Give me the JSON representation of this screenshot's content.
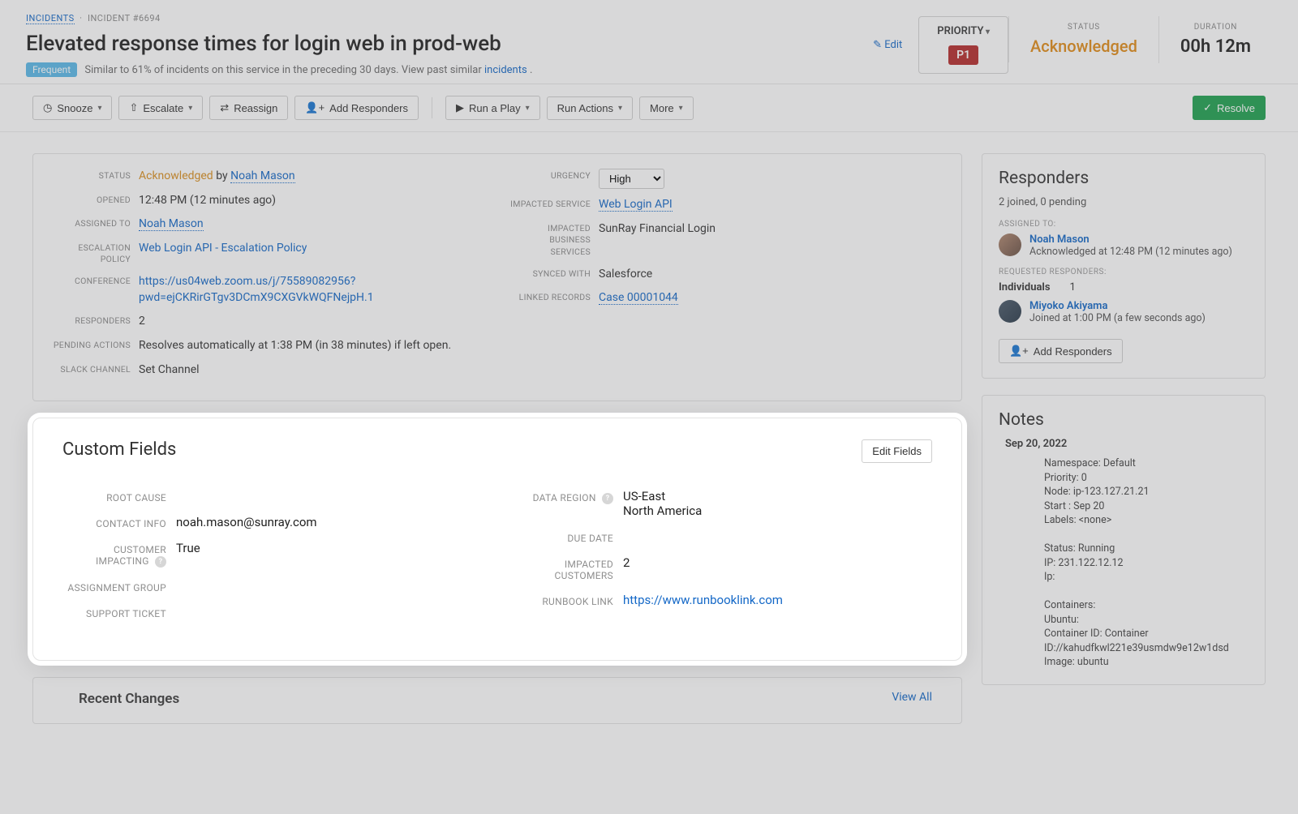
{
  "breadcrumb": {
    "root": "INCIDENTS",
    "current": "INCIDENT #6694"
  },
  "title": "Elevated response times for login web in prod-web",
  "frequentBadge": "Frequent",
  "similarText": "Similar to 61% of incidents on this service in the preceding 30 days. View past similar ",
  "incidentsLink": "incidents",
  "period": " .",
  "editLabel": "Edit",
  "headerBoxes": {
    "priorityLabel": "PRIORITY",
    "priorityValue": "P1",
    "statusLabel": "STATUS",
    "statusValue": "Acknowledged",
    "durationLabel": "DURATION",
    "durationValue": "00h 12m"
  },
  "actions": {
    "snooze": "Snooze",
    "escalate": "Escalate",
    "reassign": "Reassign",
    "addResponders": "Add Responders",
    "runPlay": "Run a Play",
    "runActions": "Run Actions",
    "more": "More",
    "resolve": "Resolve"
  },
  "details": {
    "left": {
      "statusLabel": "STATUS",
      "statusValue": "Acknowledged",
      "statusBy": "by",
      "statusUser": "Noah Mason",
      "openedLabel": "OPENED",
      "openedValue": "12:48 PM (12 minutes ago)",
      "assignedLabel": "ASSIGNED TO",
      "assignedValue": "Noah Mason",
      "escalationLabel": "ESCALATION POLICY",
      "escalationValue": "Web Login API - Escalation Policy",
      "conferenceLabel": "CONFERENCE",
      "conferenceValue": "https://us04web.zoom.us/j/75589082956?pwd=ejCKRirGTgv3DCmX9CXGVkWQFNejpH.1",
      "respondersLabel": "RESPONDERS",
      "respondersValue": "2",
      "pendingLabel": "PENDING ACTIONS",
      "pendingValue": "Resolves automatically at 1:38 PM (in 38 minutes) if left open.",
      "slackLabel": "SLACK CHANNEL",
      "slackValue": "Set Channel"
    },
    "right": {
      "urgencyLabel": "URGENCY",
      "urgencyValue": "High",
      "impactedServiceLabel": "IMPACTED SERVICE",
      "impactedServiceValue": "Web Login API",
      "impactedBizLabel": "IMPACTED BUSINESS SERVICES",
      "impactedBizValue": "SunRay Financial Login",
      "syncedLabel": "SYNCED WITH",
      "syncedValue": "Salesforce",
      "linkedLabel": "LINKED RECORDS",
      "linkedValue": "Case 00001044"
    }
  },
  "customFields": {
    "title": "Custom Fields",
    "editBtn": "Edit Fields",
    "left": {
      "rootCauseLabel": "ROOT CAUSE",
      "rootCauseValue": "",
      "contactLabel": "CONTACT INFO",
      "contactValue": "noah.mason@sunray.com",
      "customerImpactLabel": "CUSTOMER IMPACTING",
      "customerImpactValue": "True",
      "assignmentLabel": "ASSIGNMENT GROUP",
      "assignmentValue": "",
      "ticketLabel": "SUPPORT TICKET",
      "ticketValue": ""
    },
    "right": {
      "dataRegionLabel": "DATA REGION",
      "dataRegionValue1": "US-East",
      "dataRegionValue2": "North America",
      "dueDateLabel": "DUE DATE",
      "dueDateValue": "",
      "impactedCustLabel": "IMPACTED CUSTOMERS",
      "impactedCustValue": "2",
      "runbookLabel": "RUNBOOK LINK",
      "runbookValue": "https://www.runbooklink.com"
    }
  },
  "recent": {
    "title": "Recent Changes",
    "viewAll": "View All"
  },
  "responders": {
    "title": "Responders",
    "summary": "2 joined, 0 pending",
    "assignedToLabel": "ASSIGNED TO:",
    "person1": "Noah Mason",
    "person1meta": "Acknowledged at 12:48 PM (12 minutes ago)",
    "requestedLabel": "REQUESTED RESPONDERS:",
    "individualsLabel": "Individuals",
    "individualsCount": "1",
    "person2": "Miyoko Akiyama",
    "person2meta": "Joined at 1:00 PM (a few seconds ago)",
    "addBtn": "Add Responders"
  },
  "notes": {
    "title": "Notes",
    "date": "Sep 20, 2022",
    "lines": [
      "Namespace: Default",
      "Priority: 0",
      "Node: ip-123.127.21.21",
      "Start : Sep 20",
      "Labels: <none>",
      "",
      "Status: Running",
      "IP: 231.122.12.12",
      "Ip:",
      "",
      "Containers:",
      "Ubuntu:",
      "Container ID: Container ID://kahudfkwl221e39usmdw9e12w1dsd",
      "Image: ubuntu"
    ]
  }
}
